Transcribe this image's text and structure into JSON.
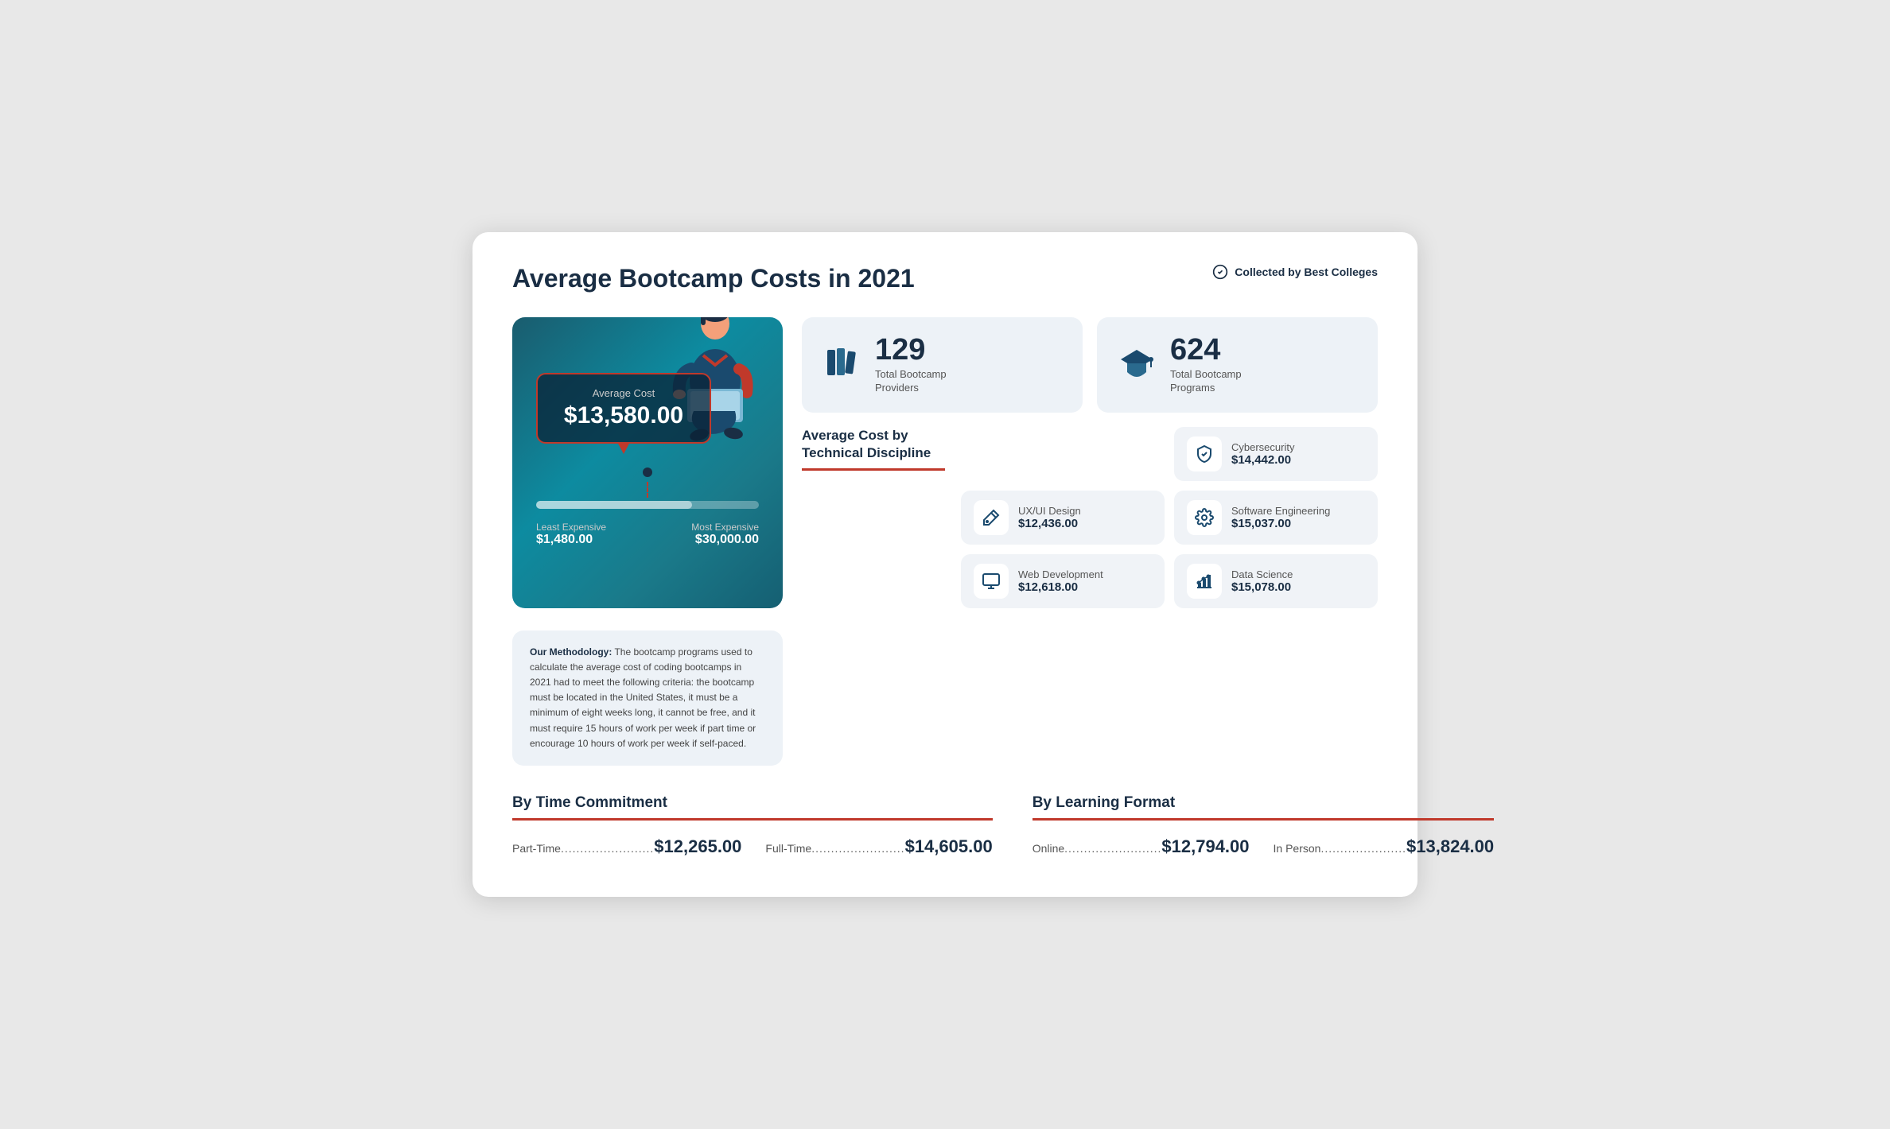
{
  "header": {
    "title": "Average Bootcamp Costs in 2021",
    "collected_by": "Collected by Best Colleges"
  },
  "cost_panel": {
    "avg_label": "Average Cost",
    "avg_value": "$13,580.00",
    "least_label": "Least Expensive",
    "least_value": "$1,480.00",
    "most_label": "Most Expensive",
    "most_value": "$30,000.00"
  },
  "stats": [
    {
      "number": "129",
      "label": "Total Bootcamp\nProviders",
      "icon": "books-icon"
    },
    {
      "number": "624",
      "label": "Total Bootcamp\nPrograms",
      "icon": "graduation-icon"
    }
  ],
  "discipline": {
    "title": "Average Cost by\nTechnical Discipline",
    "items": [
      {
        "name": "Cybersecurity",
        "cost": "$14,442.00",
        "icon": "shield-icon",
        "col": "right"
      },
      {
        "name": "UX/UI Design",
        "cost": "$12,436.00",
        "icon": "design-icon",
        "col": "left"
      },
      {
        "name": "Software Engineering",
        "cost": "$15,037.00",
        "icon": "gear-icon",
        "col": "right"
      },
      {
        "name": "Web Development",
        "cost": "$12,618.00",
        "icon": "monitor-icon",
        "col": "left"
      },
      {
        "name": "Data Science",
        "cost": "$15,078.00",
        "icon": "chart-icon",
        "col": "right"
      }
    ]
  },
  "methodology": {
    "bold": "Our Methodology:",
    "text": " The bootcamp programs used to calculate the average cost of coding bootcamps in 2021 had to meet the following criteria: the bootcamp must be located in the United States, it must be a minimum of eight weeks long, it cannot be free, and it must require 15 hours of work per week if part time or encourage 10 hours of work per week if self-paced."
  },
  "time_commitment": {
    "title": "By Time Commitment",
    "items": [
      {
        "label": "Part-Time",
        "dots": "........................",
        "value": "$12,265.00"
      },
      {
        "label": "Full-Time",
        "dots": "........................",
        "value": "$14,605.00"
      }
    ]
  },
  "learning_format": {
    "title": "By Learning Format",
    "items": [
      {
        "label": "Online",
        "dots": ".........................",
        "value": "$12,794.00"
      },
      {
        "label": "In Person",
        "dots": "......................",
        "value": "$13,824.00"
      }
    ]
  }
}
